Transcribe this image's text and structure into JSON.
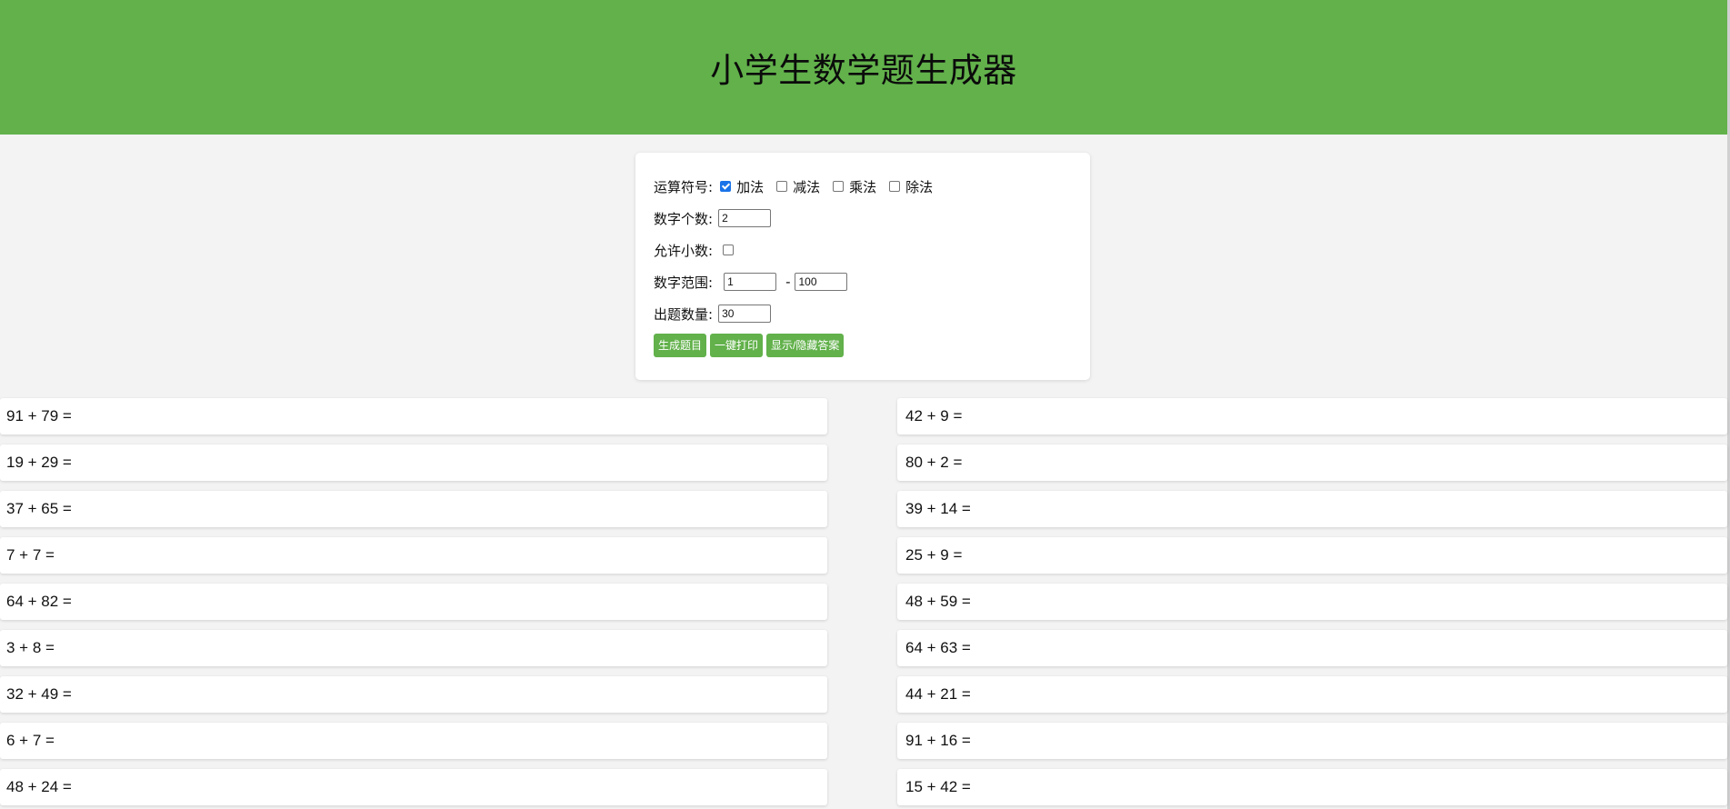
{
  "header": {
    "title": "小学生数学题生成器"
  },
  "form": {
    "operators_label": "运算符号:",
    "operators": [
      {
        "label": "加法",
        "checked": true
      },
      {
        "label": "减法",
        "checked": false
      },
      {
        "label": "乘法",
        "checked": false
      },
      {
        "label": "除法",
        "checked": false
      }
    ],
    "count_label": "数字个数:",
    "count_value": "2",
    "decimal_label": "允许小数:",
    "decimal_checked": false,
    "range_label": "数字范围:",
    "range_min": "1",
    "range_sep": "-",
    "range_max": "100",
    "quantity_label": "出题数量:",
    "quantity_value": "30",
    "buttons": {
      "generate": "生成题目",
      "print": "一键打印",
      "toggle_answers": "显示/隐藏答案"
    }
  },
  "questions": {
    "left": [
      "91 + 79 =",
      "19 + 29 =",
      "37 + 65 =",
      "7 + 7 =",
      "64 + 82 =",
      "3 + 8 =",
      "32 + 49 =",
      "6 + 7 =",
      "48 + 24 ="
    ],
    "right": [
      "42 + 9 =",
      "80 + 2 =",
      "39 + 14 =",
      "25 + 9 =",
      "48 + 59 =",
      "64 + 63 =",
      "44 + 21 =",
      "91 + 16 =",
      "15 + 42 ="
    ]
  },
  "colors": {
    "accent": "#62b14b",
    "background": "#f3f3f3",
    "checkbox_checked": "#1a73e8"
  }
}
